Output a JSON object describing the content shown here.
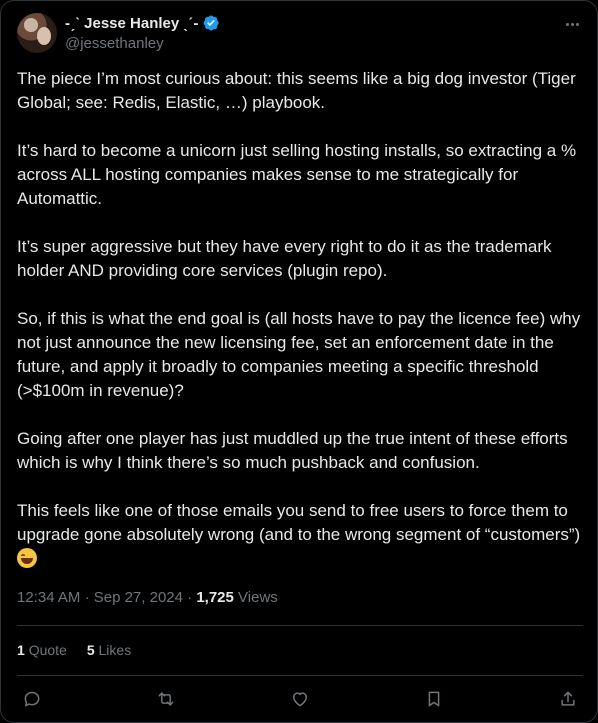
{
  "author": {
    "display_name": "-ˏˋ Jesse Hanley ˎˊ-",
    "handle": "@jessethanley"
  },
  "tweet": {
    "paragraphs": [
      "The piece I’m most curious about: this seems like a big dog investor (Tiger Global; see: Redis, Elastic, …) playbook.",
      "It’s hard to become a unicorn just selling hosting installs, so extracting a % across ALL hosting companies makes sense to me strategically for Automattic.",
      "It’s super aggressive but they have every right to do it as the trademark holder AND providing core services (plugin repo).",
      "So, if this is what the end goal is (all hosts have to pay the licence fee) why not just announce the new licensing fee, set an enforcement date in the future, and apply it broadly to companies meeting a specific threshold (>$100m in revenue)?",
      "Going after one player has just muddled up the true intent of these efforts which is why I think there’s so much pushback and confusion.",
      "This feels like one of those emails you send to free users to force them to upgrade gone absolutely wrong (and to the wrong segment of “customers”)"
    ],
    "emoji": "grinning-face-emoji"
  },
  "meta": {
    "time": "12:34 AM",
    "separator": "·",
    "date": "Sep 27, 2024",
    "views_count": "1,725",
    "views_label": "Views"
  },
  "stats": {
    "quotes_count": "1",
    "quotes_label": "Quote",
    "likes_count": "5",
    "likes_label": "Likes"
  },
  "colors": {
    "background": "#000000",
    "text": "#e7e9ea",
    "secondary": "#71767b",
    "verified": "#1d9bf0",
    "border": "#2f3336"
  },
  "icons": [
    "verified-badge-icon",
    "more-icon",
    "reply-icon",
    "retweet-icon",
    "like-icon",
    "bookmark-icon",
    "share-icon"
  ]
}
